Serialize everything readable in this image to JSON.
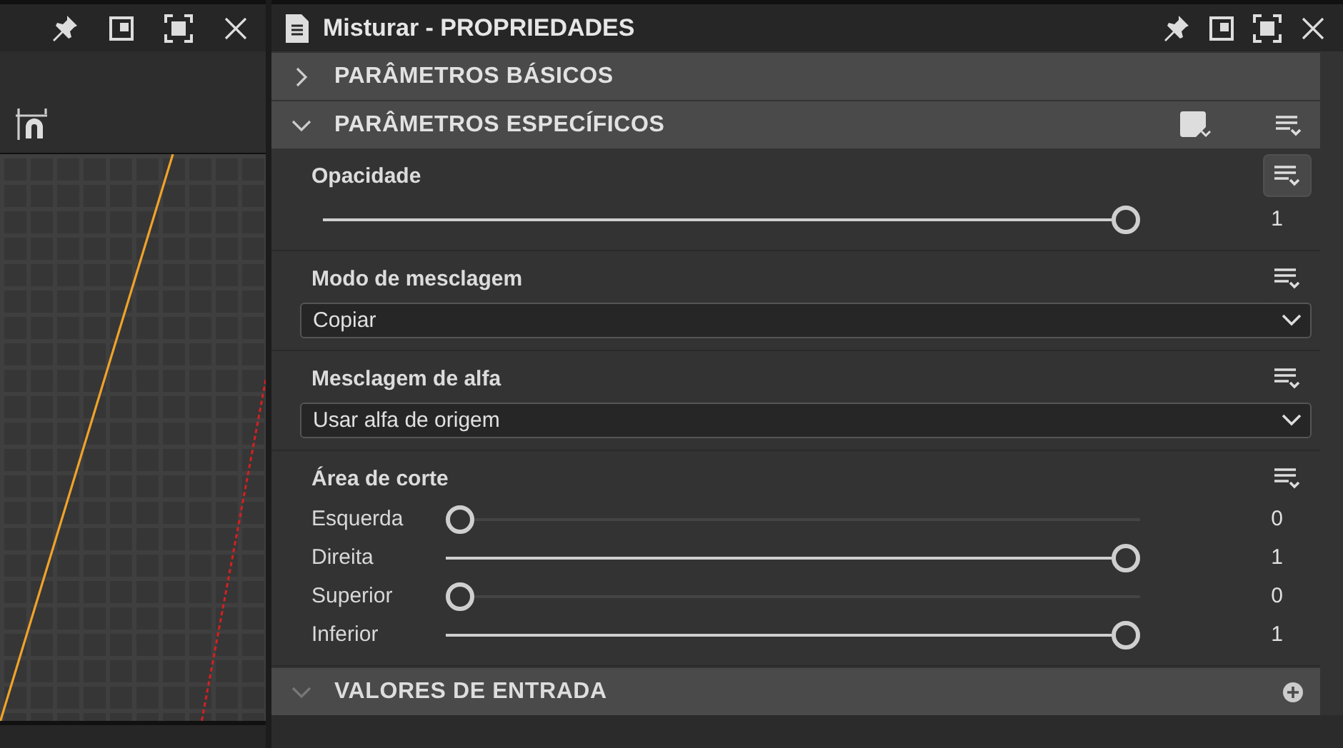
{
  "left_panel": {
    "kind": "curve_editor"
  },
  "properties_panel": {
    "title": "Misturar - PROPRIEDADES",
    "sections": [
      {
        "title": "PARÂMETROS BÁSICOS",
        "expanded": false,
        "disabled": false
      },
      {
        "title": "PARÂMETROS ESPECÍFICOS",
        "expanded": true,
        "disabled": false,
        "groups": [
          {
            "kind": "slider",
            "label": "Opacidade",
            "hovered": true,
            "level": 1,
            "reading": "1"
          },
          {
            "kind": "dropdown",
            "label": "Modo de mesclagem",
            "hovered": false,
            "value": "Copiar"
          },
          {
            "kind": "dropdown",
            "label": "Mesclagem de alfa",
            "hovered": false,
            "value": "Usar alfa de origem"
          },
          {
            "kind": "slider_list",
            "label": "Área de corte",
            "hovered": false,
            "sliders": [
              {
                "label": "Esquerda",
                "level": 0,
                "reading": "0"
              },
              {
                "label": "Direita",
                "level": 1,
                "reading": "1"
              },
              {
                "label": "Superior",
                "level": 0,
                "reading": "0"
              },
              {
                "label": "Inferior",
                "level": 1,
                "reading": "1"
              }
            ]
          }
        ]
      },
      {
        "title": "VALORES DE ENTRADA",
        "expanded": true,
        "disabled": true
      }
    ]
  }
}
